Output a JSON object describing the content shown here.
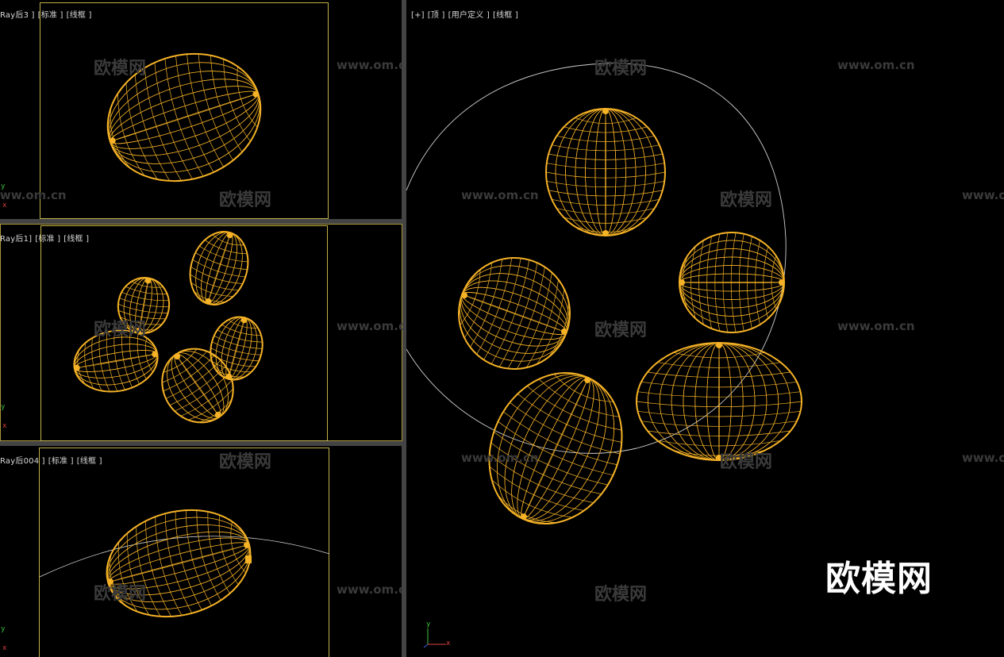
{
  "viewports": {
    "v1": {
      "label": [
        "Ray后3 ]",
        "[标准 ]",
        "[线框 ]"
      ]
    },
    "v2": {
      "label": [
        "Ray后1]",
        "[标准 ]",
        "[线框 ]"
      ]
    },
    "v3": {
      "label": [
        "Ray后004 ]",
        "[标准 ]",
        "[线框 ]"
      ]
    },
    "v4": {
      "label": [
        "[+]",
        "[顶 ]",
        "[用户定义 ]",
        "[线框 ]"
      ]
    }
  },
  "watermark": {
    "cn": "欧模网",
    "url": "www.om.cn",
    "big": "欧模网"
  },
  "axis": {
    "y": "y",
    "x": "x"
  },
  "colors": {
    "wire": "#f5b226",
    "frame": "#c2b34a",
    "circle": "#cfcfcf",
    "background": "#000000"
  }
}
